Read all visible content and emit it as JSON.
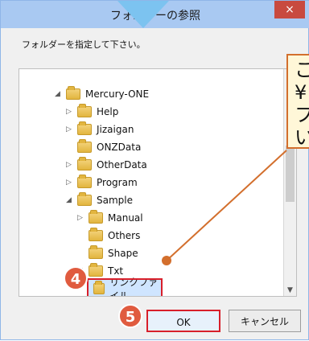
{
  "window": {
    "title": "フォルダーの参照",
    "close_label": "×"
  },
  "prompt": "フォルダーを指定して下さい。",
  "tree": {
    "rows": [
      {
        "label": "Mercury-ONE",
        "tri": "◢"
      },
      {
        "label": "Help",
        "tri": "▷"
      },
      {
        "label": "Jizaigan",
        "tri": "▷"
      },
      {
        "label": "ONZData",
        "tri": ""
      },
      {
        "label": "OtherData",
        "tri": "▷"
      },
      {
        "label": "Program",
        "tri": "▷"
      },
      {
        "label": "Sample",
        "tri": "◢"
      },
      {
        "label": "Manual",
        "tri": "▷"
      },
      {
        "label": "Others",
        "tri": ""
      },
      {
        "label": "Shape",
        "tri": ""
      },
      {
        "label": "Txt",
        "tri": "◢"
      },
      {
        "label": "リンクファイル",
        "tri": ""
      }
    ]
  },
  "buttons": {
    "ok_label": "OK",
    "cancel_label": "キャンセル"
  },
  "badges": {
    "step4": "4",
    "step5": "5"
  },
  "callout": {
    "text": "こ\n¥\nフ\nい"
  },
  "colors": {
    "accent_red": "#d81f2a",
    "badge_orange": "#e05b3f",
    "callout_border": "#d36f2d",
    "title_blue": "#a9c9f2"
  }
}
